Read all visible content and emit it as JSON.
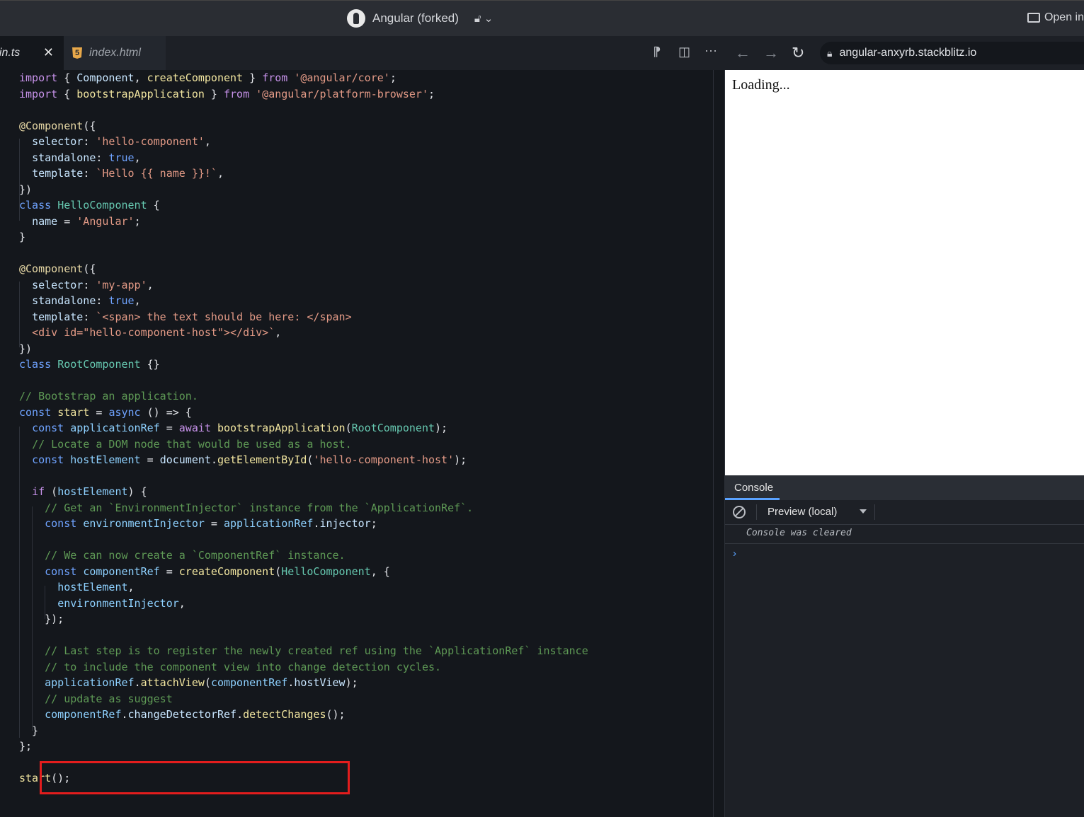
{
  "topbar": {
    "project_title": "Angular (forked)",
    "open_label": "Open in"
  },
  "editor_tabs": [
    {
      "label": "main.ts",
      "display": "ain.ts",
      "active": true
    },
    {
      "label": "index.html",
      "active": false
    }
  ],
  "browser": {
    "url": "angular-anxyrb.stackblitz.io",
    "loading_text": "Loading..."
  },
  "console": {
    "tab_label": "Console",
    "context": "Preview (local)",
    "message": "Console was cleared"
  },
  "code_lines": [
    "import { Component, createComponent } from '@angular/core';",
    "import { bootstrapApplication } from '@angular/platform-browser';",
    "",
    "@Component({",
    "  selector: 'hello-component',",
    "  standalone: true,",
    "  template: `Hello {{ name }}!`,",
    "})",
    "class HelloComponent {",
    "  name = 'Angular';",
    "}",
    "",
    "@Component({",
    "  selector: 'my-app',",
    "  standalone: true,",
    "  template: `<span> the text should be here: </span>",
    "  <div id=\"hello-component-host\"></div>`,",
    "})",
    "class RootComponent {}",
    "",
    "// Bootstrap an application.",
    "const start = async () => {",
    "  const applicationRef = await bootstrapApplication(RootComponent);",
    "  // Locate a DOM node that would be used as a host.",
    "  const hostElement = document.getElementById('hello-component-host');",
    "",
    "  if (hostElement) {",
    "    // Get an `EnvironmentInjector` instance from the `ApplicationRef`.",
    "    const environmentInjector = applicationRef.injector;",
    "",
    "    // We can now create a `ComponentRef` instance.",
    "    const componentRef = createComponent(HelloComponent, {",
    "      hostElement,",
    "      environmentInjector,",
    "    });",
    "",
    "    // Last step is to register the newly created ref using the `ApplicationRef` instance",
    "    // to include the component view into change detection cycles.",
    "    applicationRef.attachView(componentRef.hostView);",
    "    // update as suggest",
    "    componentRef.changeDetectorRef.detectChanges();",
    "  }",
    "};",
    "",
    "start();"
  ]
}
